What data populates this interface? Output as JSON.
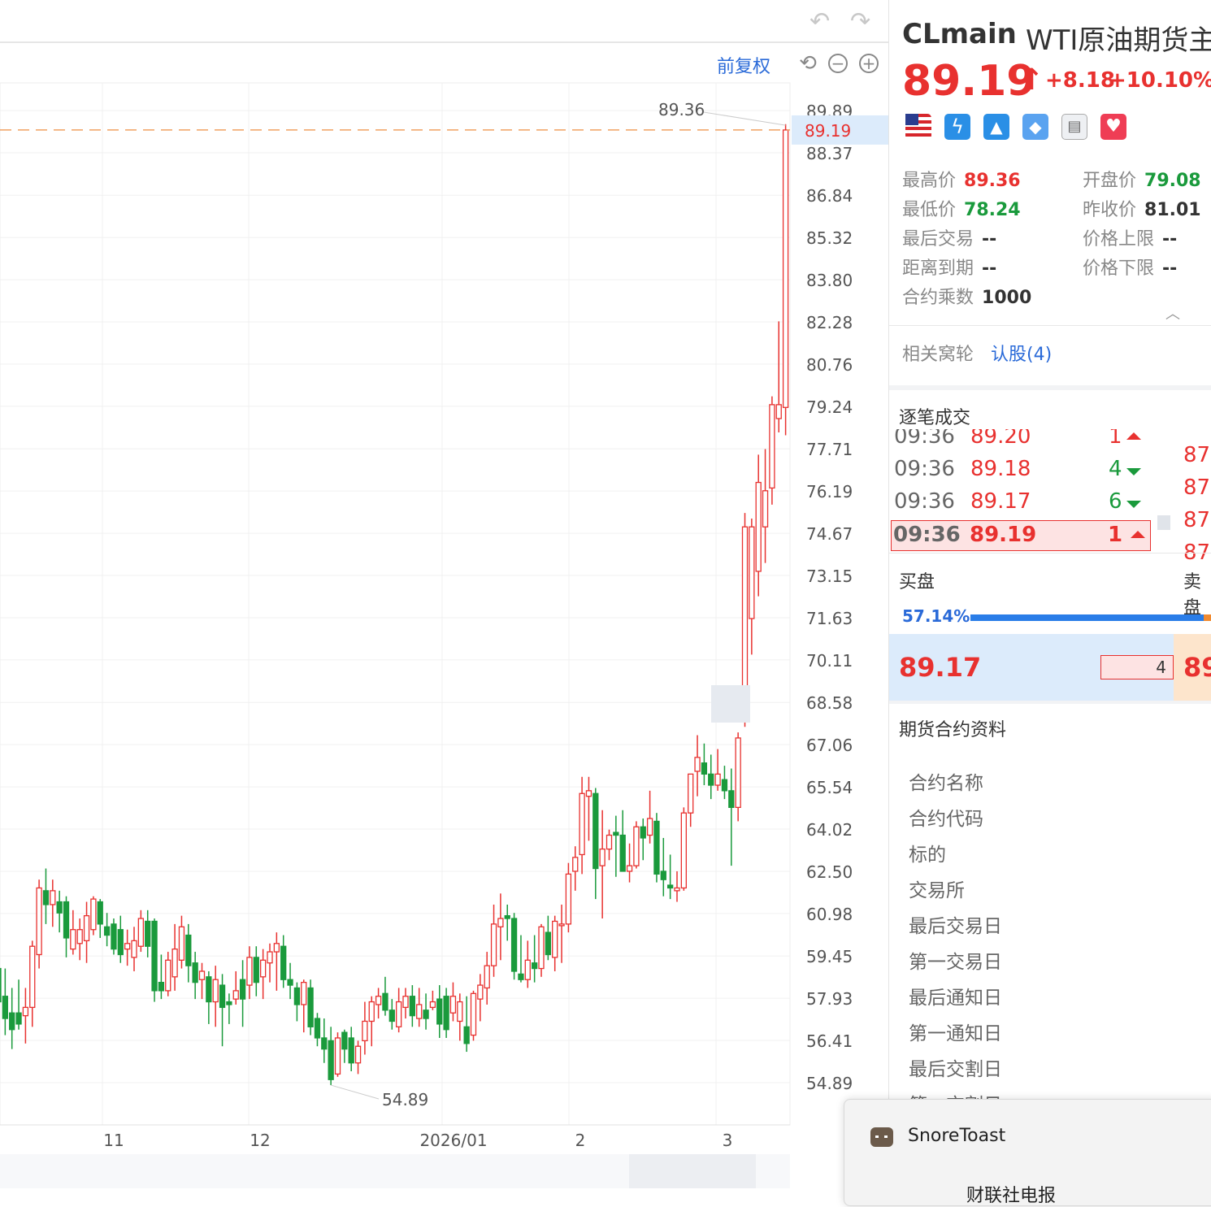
{
  "chart_data": {
    "type": "candlestick",
    "y_ticks": [
      "89.89",
      "88.37",
      "86.84",
      "85.32",
      "83.80",
      "82.28",
      "80.76",
      "79.24",
      "77.71",
      "76.19",
      "74.67",
      "73.15",
      "71.63",
      "70.11",
      "68.58",
      "67.06",
      "65.54",
      "64.02",
      "62.50",
      "60.98",
      "59.45",
      "57.93",
      "56.41",
      "54.89"
    ],
    "x_ticks": [
      "11",
      "12",
      "2026/01",
      "2",
      "3"
    ],
    "current_price_label": "89.19",
    "high_annotation": "89.36",
    "low_annotation": "54.89",
    "ylim": [
      54.89,
      89.89
    ],
    "candles": [
      {
        "o": 59.0,
        "h": 59.9,
        "l": 57.2,
        "c": 57.8
      },
      {
        "o": 58.0,
        "h": 59.0,
        "l": 56.6,
        "c": 57.2
      },
      {
        "o": 57.4,
        "h": 58.3,
        "l": 56.1,
        "c": 56.8
      },
      {
        "o": 57.4,
        "h": 58.6,
        "l": 56.8,
        "c": 57.0
      },
      {
        "o": 57.3,
        "h": 58.3,
        "l": 56.3,
        "c": 57.6
      },
      {
        "o": 57.6,
        "h": 60.0,
        "l": 56.9,
        "c": 59.8
      },
      {
        "o": 59.5,
        "h": 62.2,
        "l": 59.0,
        "c": 61.9
      },
      {
        "o": 61.8,
        "h": 62.6,
        "l": 60.6,
        "c": 61.3
      },
      {
        "o": 61.3,
        "h": 62.2,
        "l": 60.5,
        "c": 61.8
      },
      {
        "o": 61.4,
        "h": 61.8,
        "l": 60.3,
        "c": 61.0
      },
      {
        "o": 61.4,
        "h": 61.6,
        "l": 59.4,
        "c": 60.1
      },
      {
        "o": 59.7,
        "h": 61.1,
        "l": 59.5,
        "c": 60.4
      },
      {
        "o": 59.9,
        "h": 60.8,
        "l": 59.3,
        "c": 60.4
      },
      {
        "o": 60.0,
        "h": 61.4,
        "l": 59.2,
        "c": 60.9
      },
      {
        "o": 60.4,
        "h": 61.6,
        "l": 60.2,
        "c": 61.5
      },
      {
        "o": 61.4,
        "h": 61.5,
        "l": 60.1,
        "c": 60.6
      },
      {
        "o": 60.5,
        "h": 61.0,
        "l": 59.8,
        "c": 60.2
      },
      {
        "o": 60.6,
        "h": 60.8,
        "l": 59.5,
        "c": 59.7
      },
      {
        "o": 60.4,
        "h": 60.9,
        "l": 59.2,
        "c": 59.5
      },
      {
        "o": 59.7,
        "h": 60.4,
        "l": 59.1,
        "c": 59.9
      },
      {
        "o": 59.4,
        "h": 60.5,
        "l": 58.9,
        "c": 60.0
      },
      {
        "o": 59.8,
        "h": 61.1,
        "l": 59.6,
        "c": 60.8
      },
      {
        "o": 60.7,
        "h": 61.1,
        "l": 59.4,
        "c": 59.8
      },
      {
        "o": 60.7,
        "h": 60.8,
        "l": 57.8,
        "c": 58.2
      },
      {
        "o": 58.5,
        "h": 59.5,
        "l": 57.9,
        "c": 58.2
      },
      {
        "o": 58.2,
        "h": 59.6,
        "l": 58.0,
        "c": 59.3
      },
      {
        "o": 58.7,
        "h": 60.6,
        "l": 58.2,
        "c": 59.7
      },
      {
        "o": 59.3,
        "h": 60.9,
        "l": 59.0,
        "c": 60.5
      },
      {
        "o": 60.2,
        "h": 60.6,
        "l": 58.5,
        "c": 59.1
      },
      {
        "o": 59.2,
        "h": 59.6,
        "l": 57.9,
        "c": 58.5
      },
      {
        "o": 58.6,
        "h": 59.2,
        "l": 57.9,
        "c": 58.9
      },
      {
        "o": 58.7,
        "h": 58.9,
        "l": 57.0,
        "c": 57.8
      },
      {
        "o": 57.8,
        "h": 59.1,
        "l": 56.9,
        "c": 58.6
      },
      {
        "o": 58.4,
        "h": 58.8,
        "l": 56.2,
        "c": 57.6
      },
      {
        "o": 57.8,
        "h": 58.1,
        "l": 57.0,
        "c": 57.7
      },
      {
        "o": 57.9,
        "h": 58.9,
        "l": 57.7,
        "c": 58.2
      },
      {
        "o": 58.6,
        "h": 59.3,
        "l": 56.9,
        "c": 57.9
      },
      {
        "o": 58.4,
        "h": 59.8,
        "l": 57.9,
        "c": 59.4
      },
      {
        "o": 59.4,
        "h": 59.8,
        "l": 58.0,
        "c": 58.5
      },
      {
        "o": 58.7,
        "h": 59.7,
        "l": 57.9,
        "c": 59.3
      },
      {
        "o": 59.2,
        "h": 59.9,
        "l": 58.5,
        "c": 59.6
      },
      {
        "o": 59.6,
        "h": 60.3,
        "l": 58.2,
        "c": 59.9
      },
      {
        "o": 59.8,
        "h": 60.2,
        "l": 58.3,
        "c": 58.6
      },
      {
        "o": 58.6,
        "h": 59.2,
        "l": 57.9,
        "c": 58.4
      },
      {
        "o": 58.3,
        "h": 58.5,
        "l": 57.1,
        "c": 57.7
      },
      {
        "o": 57.7,
        "h": 58.6,
        "l": 56.7,
        "c": 58.5
      },
      {
        "o": 58.3,
        "h": 58.6,
        "l": 56.6,
        "c": 56.9
      },
      {
        "o": 57.2,
        "h": 57.4,
        "l": 56.2,
        "c": 56.5
      },
      {
        "o": 56.5,
        "h": 57.2,
        "l": 55.6,
        "c": 56.1
      },
      {
        "o": 56.4,
        "h": 56.9,
        "l": 54.8,
        "c": 55.0
      },
      {
        "o": 55.2,
        "h": 56.7,
        "l": 55.1,
        "c": 56.5
      },
      {
        "o": 56.7,
        "h": 56.8,
        "l": 55.6,
        "c": 56.1
      },
      {
        "o": 56.5,
        "h": 56.9,
        "l": 55.3,
        "c": 55.6
      },
      {
        "o": 55.6,
        "h": 56.4,
        "l": 55.2,
        "c": 56.2
      },
      {
        "o": 56.4,
        "h": 57.8,
        "l": 55.9,
        "c": 57.1
      },
      {
        "o": 57.1,
        "h": 58.0,
        "l": 56.2,
        "c": 57.8
      },
      {
        "o": 57.7,
        "h": 58.3,
        "l": 57.2,
        "c": 58.0
      },
      {
        "o": 58.1,
        "h": 58.7,
        "l": 57.3,
        "c": 57.5
      },
      {
        "o": 57.5,
        "h": 57.9,
        "l": 56.8,
        "c": 57.1
      },
      {
        "o": 56.9,
        "h": 58.3,
        "l": 56.7,
        "c": 57.8
      },
      {
        "o": 57.6,
        "h": 58.3,
        "l": 57.2,
        "c": 58.0
      },
      {
        "o": 58.0,
        "h": 58.4,
        "l": 56.9,
        "c": 57.3
      },
      {
        "o": 57.2,
        "h": 58.3,
        "l": 56.9,
        "c": 57.7
      },
      {
        "o": 57.5,
        "h": 58.1,
        "l": 56.8,
        "c": 57.2
      },
      {
        "o": 57.6,
        "h": 58.2,
        "l": 57.5,
        "c": 57.8
      },
      {
        "o": 57.9,
        "h": 58.4,
        "l": 56.5,
        "c": 57.0
      },
      {
        "o": 58.0,
        "h": 58.3,
        "l": 56.5,
        "c": 56.8
      },
      {
        "o": 57.4,
        "h": 58.5,
        "l": 57.1,
        "c": 58.0
      },
      {
        "o": 57.1,
        "h": 58.1,
        "l": 56.4,
        "c": 57.8
      },
      {
        "o": 56.9,
        "h": 58.0,
        "l": 56.0,
        "c": 56.3
      },
      {
        "o": 56.6,
        "h": 58.2,
        "l": 56.4,
        "c": 58.1
      },
      {
        "o": 57.9,
        "h": 58.8,
        "l": 57.1,
        "c": 58.4
      },
      {
        "o": 58.3,
        "h": 59.6,
        "l": 57.7,
        "c": 59.1
      },
      {
        "o": 59.1,
        "h": 61.3,
        "l": 58.7,
        "c": 60.6
      },
      {
        "o": 60.5,
        "h": 61.7,
        "l": 59.3,
        "c": 60.8
      },
      {
        "o": 60.9,
        "h": 61.3,
        "l": 60.0,
        "c": 60.8
      },
      {
        "o": 60.8,
        "h": 61.0,
        "l": 58.6,
        "c": 58.9
      },
      {
        "o": 58.8,
        "h": 60.2,
        "l": 58.5,
        "c": 58.6
      },
      {
        "o": 58.6,
        "h": 60.0,
        "l": 58.3,
        "c": 59.3
      },
      {
        "o": 59.2,
        "h": 60.2,
        "l": 58.5,
        "c": 59.0
      },
      {
        "o": 59.0,
        "h": 60.6,
        "l": 58.7,
        "c": 60.5
      },
      {
        "o": 60.3,
        "h": 60.9,
        "l": 59.3,
        "c": 59.5
      },
      {
        "o": 59.4,
        "h": 60.9,
        "l": 58.9,
        "c": 60.7
      },
      {
        "o": 60.6,
        "h": 61.3,
        "l": 59.2,
        "c": 60.6
      },
      {
        "o": 60.6,
        "h": 62.8,
        "l": 60.3,
        "c": 62.4
      },
      {
        "o": 62.5,
        "h": 63.4,
        "l": 61.8,
        "c": 63.0
      },
      {
        "o": 63.1,
        "h": 65.9,
        "l": 62.4,
        "c": 65.3
      },
      {
        "o": 65.2,
        "h": 65.9,
        "l": 63.6,
        "c": 65.4
      },
      {
        "o": 65.3,
        "h": 65.5,
        "l": 61.5,
        "c": 62.6
      },
      {
        "o": 62.7,
        "h": 64.7,
        "l": 60.8,
        "c": 63.3
      },
      {
        "o": 63.3,
        "h": 64.0,
        "l": 62.9,
        "c": 63.8
      },
      {
        "o": 63.9,
        "h": 64.5,
        "l": 62.3,
        "c": 63.8
      },
      {
        "o": 63.8,
        "h": 64.7,
        "l": 62.5,
        "c": 62.5
      },
      {
        "o": 62.5,
        "h": 63.5,
        "l": 62.1,
        "c": 62.7
      },
      {
        "o": 62.7,
        "h": 64.3,
        "l": 62.6,
        "c": 64.1
      },
      {
        "o": 64.1,
        "h": 64.4,
        "l": 62.9,
        "c": 63.7
      },
      {
        "o": 63.8,
        "h": 65.4,
        "l": 63.5,
        "c": 64.4
      },
      {
        "o": 64.3,
        "h": 64.6,
        "l": 62.1,
        "c": 62.4
      },
      {
        "o": 62.5,
        "h": 63.7,
        "l": 61.6,
        "c": 62.2
      },
      {
        "o": 62.0,
        "h": 63.1,
        "l": 61.5,
        "c": 61.9
      },
      {
        "o": 61.8,
        "h": 62.5,
        "l": 61.4,
        "c": 61.9
      },
      {
        "o": 61.9,
        "h": 64.8,
        "l": 61.8,
        "c": 64.6
      },
      {
        "o": 64.6,
        "h": 66.0,
        "l": 64.1,
        "c": 66.0
      },
      {
        "o": 66.1,
        "h": 67.4,
        "l": 65.2,
        "c": 66.6
      },
      {
        "o": 66.4,
        "h": 67.1,
        "l": 65.6,
        "c": 66.0
      },
      {
        "o": 66.0,
        "h": 66.7,
        "l": 65.1,
        "c": 65.6
      },
      {
        "o": 65.6,
        "h": 66.9,
        "l": 65.4,
        "c": 66.0
      },
      {
        "o": 65.8,
        "h": 66.3,
        "l": 65.1,
        "c": 65.4
      },
      {
        "o": 65.4,
        "h": 66.2,
        "l": 62.7,
        "c": 64.8
      },
      {
        "o": 64.8,
        "h": 67.5,
        "l": 64.3,
        "c": 67.3
      },
      {
        "o": 68.4,
        "h": 75.4,
        "l": 67.7,
        "c": 74.9
      },
      {
        "o": 71.6,
        "h": 75.2,
        "l": 70.3,
        "c": 74.9
      },
      {
        "o": 73.3,
        "h": 77.5,
        "l": 72.4,
        "c": 76.5
      },
      {
        "o": 74.9,
        "h": 77.7,
        "l": 73.6,
        "c": 76.2
      },
      {
        "o": 76.3,
        "h": 79.6,
        "l": 75.7,
        "c": 79.3
      },
      {
        "o": 78.8,
        "h": 82.3,
        "l": 78.3,
        "c": 79.3
      },
      {
        "o": 79.2,
        "h": 89.4,
        "l": 78.2,
        "c": 89.19
      }
    ],
    "colors": {
      "up": "#e8312f",
      "down": "#1a9a3c",
      "dashed_price": "#f0a060"
    }
  },
  "toolbar": {
    "fuquan": "前复权",
    "undo_icon": "undo-arrow-icon",
    "redo_icon": "redo-arrow-icon",
    "reset_icon": "reset-icon",
    "zoom_out_icon": "zoom-out-icon",
    "zoom_in_icon": "zoom-in-icon"
  },
  "quote": {
    "symbol": "CLmain",
    "name": "WTI原油期货主",
    "price": "89.19",
    "change": "+8.18",
    "change_pct": "+10.10%",
    "badges": [
      "us-flag-icon",
      "lightning-icon",
      "tiers-icon",
      "tag-icon",
      "note-icon",
      "heart-icon"
    ]
  },
  "stats": {
    "high_label": "最高价",
    "high": "89.36",
    "open_label": "开盘价",
    "open": "79.08",
    "low_label": "最低价",
    "low": "78.24",
    "prev_label": "昨收价",
    "prev": "81.01",
    "last_trade_label": "最后交易",
    "last_trade": "--",
    "upper_label": "价格上限",
    "upper": "--",
    "expiry_label": "距离到期",
    "expiry": "--",
    "lower_label": "价格下限",
    "lower": "--",
    "mult_label": "合约乘数",
    "mult": "1000"
  },
  "warrants": {
    "label": "相关窝轮",
    "link": "认股(4)"
  },
  "ticks": {
    "title": "逐笔成交",
    "rows": [
      {
        "time": "09:36",
        "price": "89.20",
        "vol": "1",
        "dir": "up"
      },
      {
        "time": "09:36",
        "price": "89.18",
        "vol": "4",
        "dir": "down"
      },
      {
        "time": "09:36",
        "price": "89.17",
        "vol": "6",
        "dir": "down"
      },
      {
        "time": "09:36",
        "price": "89.19",
        "vol": "1",
        "dir": "up"
      }
    ],
    "right_col": [
      "87.",
      "87.",
      "87.",
      "87."
    ]
  },
  "orderbook": {
    "buy_label": "买盘",
    "sell_label": "卖盘",
    "buy_pct": "57.14%",
    "bid_price": "89.17",
    "bid_vol": "4",
    "ask_price": "89"
  },
  "contract": {
    "title": "期货合约资料",
    "items": [
      "合约名称",
      "合约代码",
      "标的",
      "交易所",
      "最后交易日",
      "第一交易日",
      "最后通知日",
      "第一通知日",
      "最后交割日",
      "第一交割日"
    ]
  },
  "toast": {
    "app": "SnoreToast",
    "line": "财联社电报"
  }
}
